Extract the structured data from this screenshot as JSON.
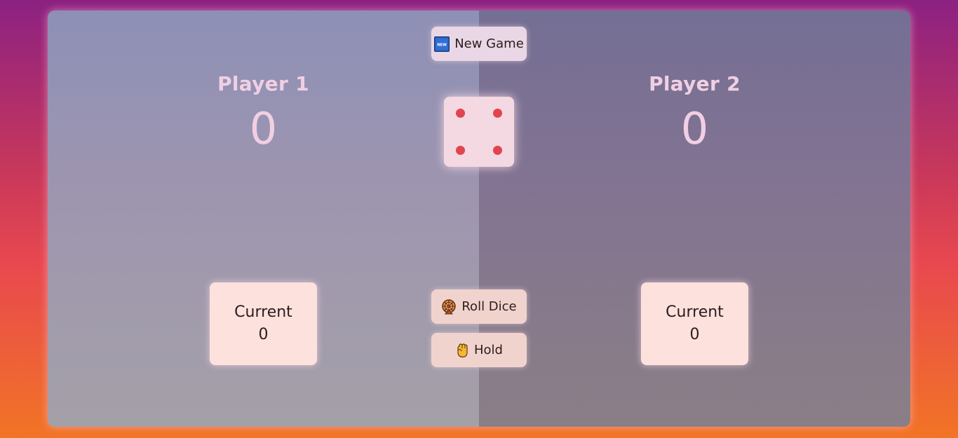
{
  "players": [
    {
      "name": "Player 1",
      "score": "0",
      "current_label": "Current",
      "current_value": "0",
      "active": true
    },
    {
      "name": "Player 2",
      "score": "0",
      "current_label": "Current",
      "current_value": "0",
      "active": false
    }
  ],
  "controls": {
    "new_game_label": "New Game",
    "new_game_icon": "new-badge-icon",
    "roll_label": "Roll Dice",
    "roll_icon": "wheel-icon",
    "hold_label": "Hold",
    "hold_icon": "raised-fist-icon"
  },
  "dice": {
    "value": 4,
    "pip_color": "#e0454f"
  },
  "colors": {
    "background_top": "#8c2182",
    "background_bottom": "#f27425",
    "active_panel": "#9d95b0",
    "inactive_panel": "#827392",
    "current_box": "#fde1dd"
  }
}
